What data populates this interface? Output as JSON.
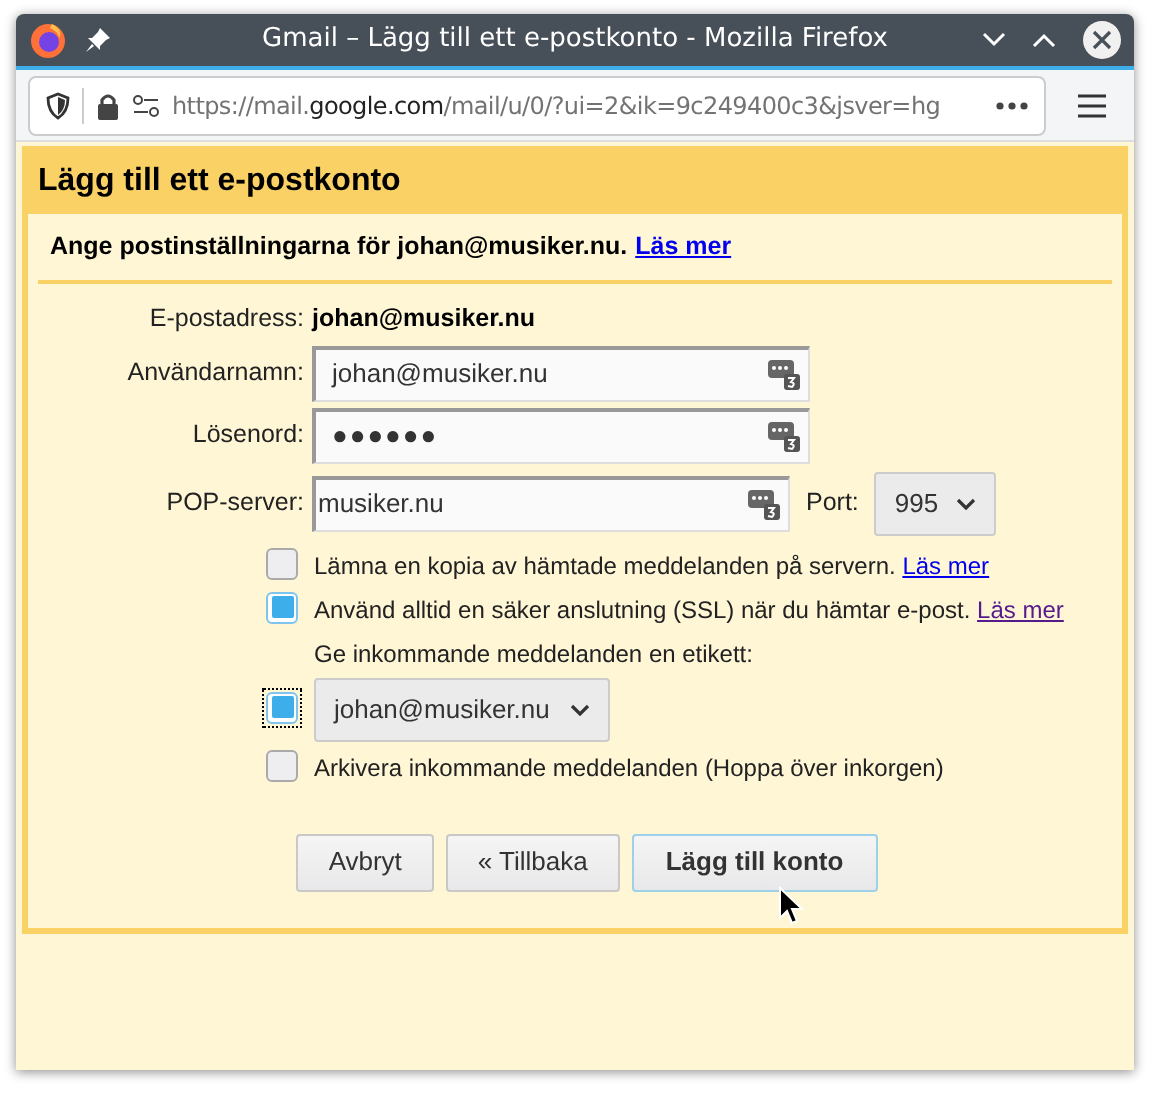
{
  "window": {
    "title": "Gmail – Lägg till ett e-postkonto - Mozilla Firefox"
  },
  "address_bar": {
    "prefix": "https://mail.",
    "domain": "google.com",
    "suffix": "/mail/u/0/?ui=2&ik=9c249400c3&jsver=hg"
  },
  "dialog": {
    "title": "Lägg till ett e-postkonto",
    "intro": {
      "text": "Ange postinställningarna för johan@musiker.nu.",
      "link": "Läs mer"
    },
    "email": {
      "label": "E-postadress:",
      "value": "johan@musiker.nu"
    },
    "username": {
      "label": "Användarnamn:",
      "value": "johan@musiker.nu"
    },
    "password": {
      "label": "Lösenord:",
      "value": "●●●●●●"
    },
    "pop_server": {
      "label": "POP-server:",
      "value": "musiker.nu"
    },
    "port": {
      "label": "Port:",
      "value": "995"
    },
    "options": [
      {
        "kind": "checkbox",
        "checked": false,
        "focused": false,
        "text": "Lämna en kopia av hämtade meddelanden på servern.",
        "link": "Läs mer",
        "link_visited": false
      },
      {
        "kind": "checkbox",
        "checked": true,
        "focused": false,
        "text": "Använd alltid en säker anslutning (SSL) när du hämtar e-post.",
        "link": "Läs mer",
        "link_visited": true
      },
      {
        "kind": "label-select",
        "checked": true,
        "focused": true,
        "text": "Ge inkommande meddelanden en etikett:",
        "value": "johan@musiker.nu"
      },
      {
        "kind": "checkbox",
        "checked": false,
        "focused": false,
        "text": "Arkivera inkommande meddelanden (Hoppa över inkorgen)"
      }
    ],
    "buttons": [
      {
        "label": "Avbryt",
        "primary": false
      },
      {
        "label": "« Tillbaka",
        "primary": false
      },
      {
        "label": "Lägg till konto",
        "primary": true
      }
    ]
  }
}
